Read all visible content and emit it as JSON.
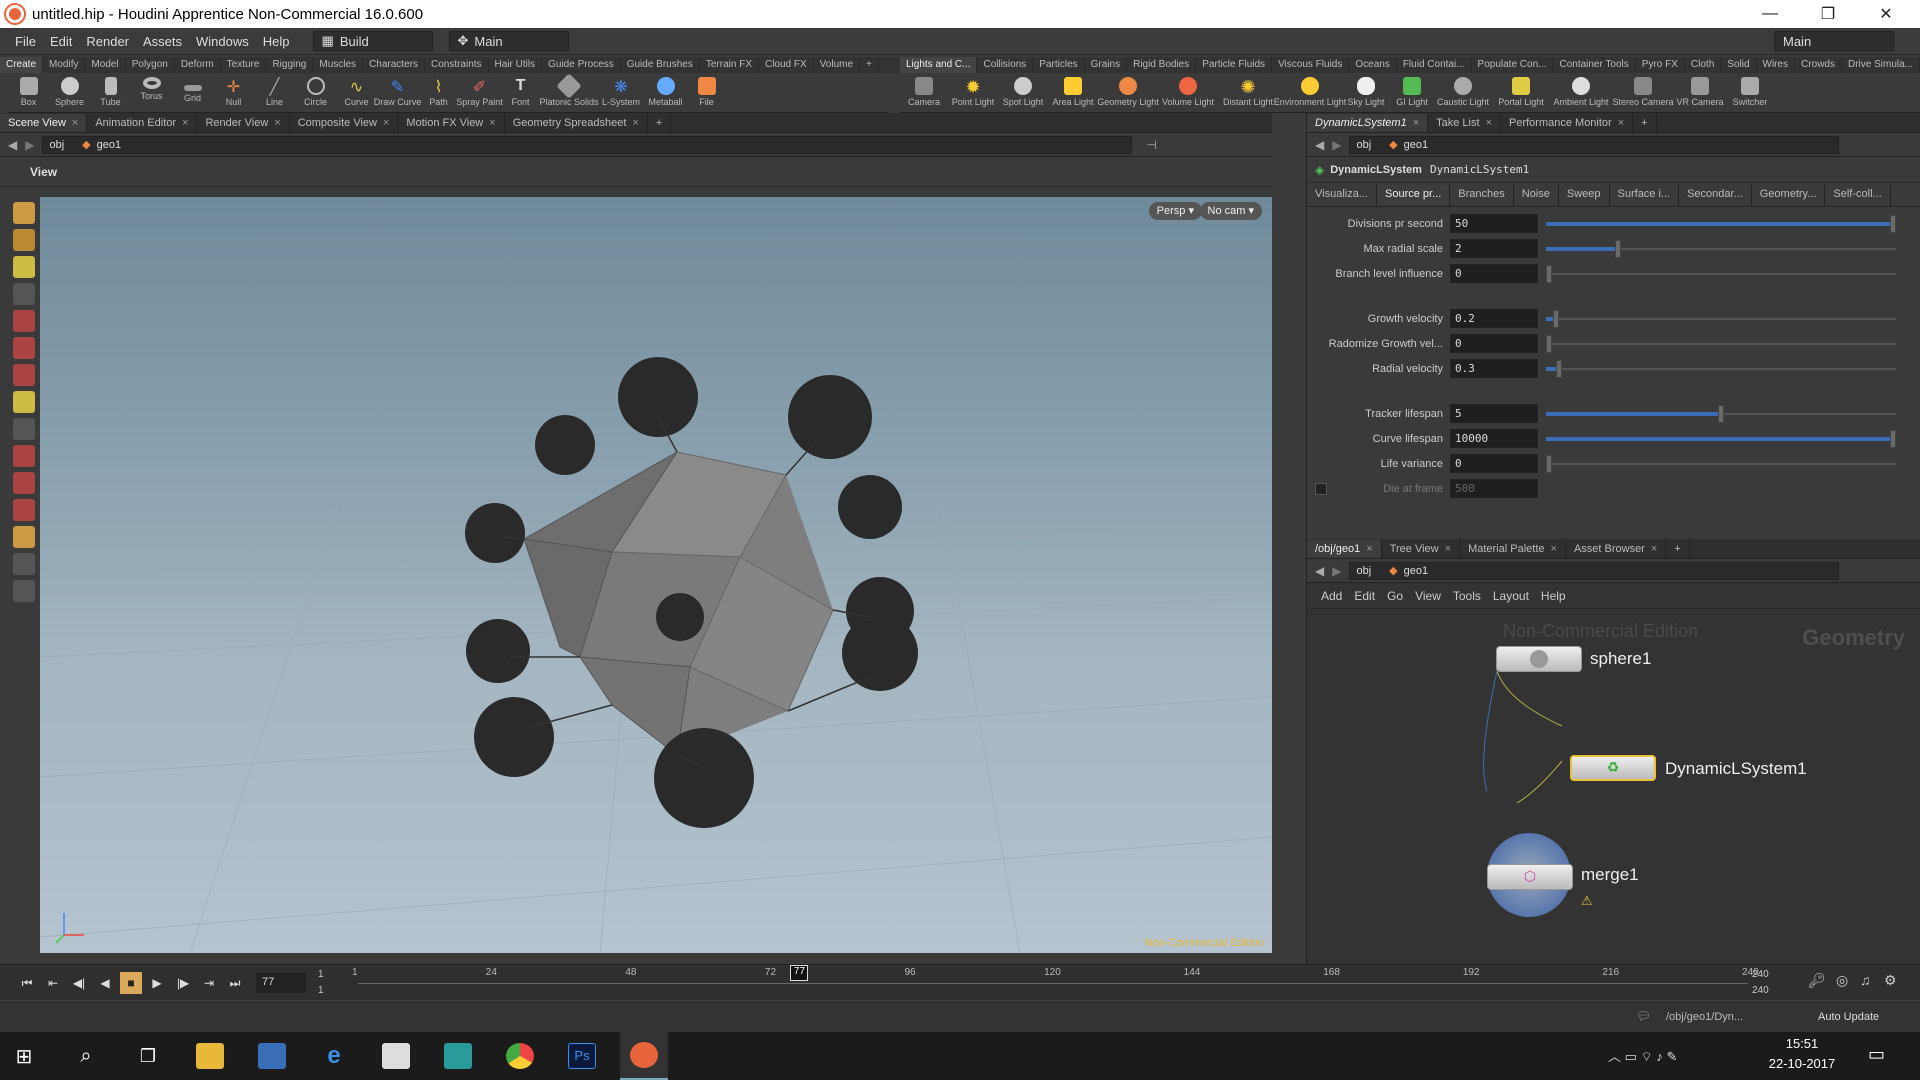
{
  "window": {
    "title": "untitled.hip - Houdini Apprentice Non-Commercial 16.0.600",
    "minimize": "—",
    "maximize": "❐",
    "close": "✕"
  },
  "menu": [
    "File",
    "Edit",
    "Render",
    "Assets",
    "Windows",
    "Help"
  ],
  "desktop": {
    "build": "Build",
    "main": "Main",
    "main_right": "Main"
  },
  "shelf_left_tabs": [
    "Create",
    "Modify",
    "Model",
    "Polygon",
    "Deform",
    "Texture",
    "Rigging",
    "Muscles",
    "Characters",
    "Constraints",
    "Hair Utils",
    "Guide Process",
    "Guide Brushes",
    "Terrain FX",
    "Cloud FX",
    "Volume"
  ],
  "shelf_left_tools": [
    "Box",
    "Sphere",
    "Tube",
    "Torus",
    "Grid",
    "Null",
    "Line",
    "Circle",
    "Curve",
    "Draw Curve",
    "Path",
    "Spray Paint",
    "Font",
    "Platonic Solids",
    "L-System",
    "Metaball",
    "File"
  ],
  "shelf_right_tabs": [
    "Lights and C...",
    "Collisions",
    "Particles",
    "Grains",
    "Rigid Bodies",
    "Particle Fluids",
    "Viscous Fluids",
    "Oceans",
    "Fluid Contai...",
    "Populate Con...",
    "Container Tools",
    "Pyro FX",
    "Cloth",
    "Solid",
    "Wires",
    "Crowds",
    "Drive Simula..."
  ],
  "shelf_right_tools": [
    "Camera",
    "Point Light",
    "Spot Light",
    "Area Light",
    "Geometry Light",
    "Volume Light",
    "Distant Light",
    "Environment Light",
    "Sky Light",
    "GI Light",
    "Caustic Light",
    "Portal Light",
    "Ambient Light",
    "Stereo Camera",
    "VR Camera",
    "Switcher"
  ],
  "left_tabs": [
    "Scene View",
    "Animation Editor",
    "Render View",
    "Composite View",
    "Motion FX View",
    "Geometry Spreadsheet"
  ],
  "left_path": {
    "root": "obj",
    "node": "geo1"
  },
  "viewport": {
    "title": "View",
    "persp": "Persp ▾",
    "cam": "No cam ▾",
    "watermark": "Non-Commercial Edition"
  },
  "right_tabs": [
    "DynamicLSystem1",
    "Take List",
    "Performance Monitor"
  ],
  "right_path": {
    "root": "obj",
    "node": "geo1"
  },
  "params": {
    "node_type": "DynamicLSystem",
    "node_name": "DynamicLSystem1",
    "tabs": [
      "Visualiza...",
      "Source pr...",
      "Branches",
      "Noise",
      "Sweep",
      "Surface i...",
      "Secondar...",
      "Geometry...",
      "Self-coll..."
    ],
    "group1": [
      {
        "label": "Divisions pr second",
        "value": "50",
        "level": 1.0
      },
      {
        "label": "Max radial scale",
        "value": "2",
        "level": 0.2
      },
      {
        "label": "Branch level influence",
        "value": "0",
        "level": 0.0
      }
    ],
    "group2": [
      {
        "label": "Growth velocity",
        "value": "0.2",
        "level": 0.02
      },
      {
        "label": "Radomize Growth vel...",
        "value": "0",
        "level": 0.0
      },
      {
        "label": "Radial velocity",
        "value": "0.3",
        "level": 0.03
      }
    ],
    "group3": [
      {
        "label": "Tracker lifespan",
        "value": "5",
        "level": 0.5
      },
      {
        "label": "Curve lifespan",
        "value": "10000",
        "level": 1.0
      },
      {
        "label": "Life variance",
        "value": "0",
        "level": 0.0
      }
    ],
    "die_label": "Die at frame",
    "die_value": "500"
  },
  "network": {
    "tabs": [
      "/obj/geo1",
      "Tree View",
      "Material Palette",
      "Asset Browser"
    ],
    "path": {
      "root": "obj",
      "node": "geo1"
    },
    "menu": [
      "Add",
      "Edit",
      "Go",
      "View",
      "Tools",
      "Layout",
      "Help"
    ],
    "watermark": "Non-Commercial Edition",
    "context": "Geometry",
    "nodes": {
      "sphere": "sphere1",
      "dyn": "DynamicLSystem1",
      "merge": "merge1"
    }
  },
  "timeline": {
    "frame": "77",
    "start": "1",
    "start2": "1",
    "end": "240",
    "end2": "240",
    "ticks": [
      "1",
      "24",
      "48",
      "72",
      "96",
      "120",
      "144",
      "168",
      "192",
      "216",
      "240"
    ],
    "current": "77",
    "current_fraction": 0.3176
  },
  "status": {
    "path": "/obj/geo1/Dyn...",
    "update": "Auto Update"
  },
  "taskbar": {
    "time": "15:51",
    "date": "22-10-2017"
  }
}
